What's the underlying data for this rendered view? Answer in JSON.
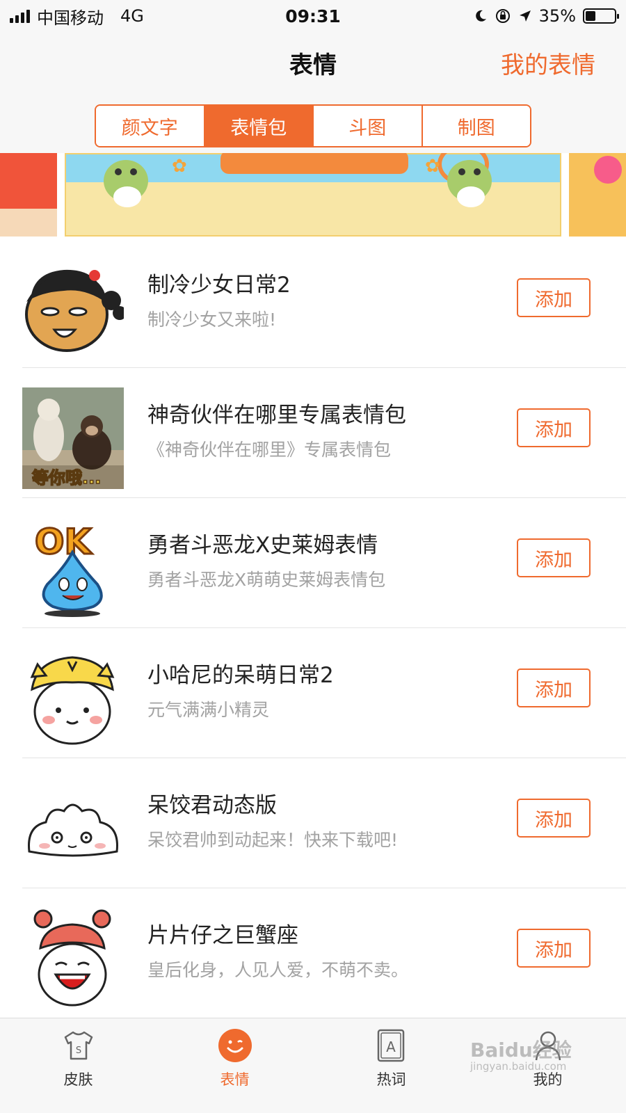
{
  "status_bar": {
    "carrier": "中国移动",
    "network": "4G",
    "time": "09:31",
    "battery": "35%",
    "battery_level": 0.35
  },
  "nav": {
    "title": "表情",
    "right_link": "我的表情"
  },
  "segments": [
    {
      "label": "颜文字",
      "active": false
    },
    {
      "label": "表情包",
      "active": true
    },
    {
      "label": "斗图",
      "active": false
    },
    {
      "label": "制图",
      "active": false
    }
  ],
  "items": [
    {
      "title": "制冷少女日常2",
      "desc": "制冷少女又来啦!",
      "button": "添加",
      "icon": "girl-face-icon"
    },
    {
      "title": "神奇伙伴在哪里专属表情包",
      "desc": "《神奇伙伴在哪里》专属表情包",
      "button": "添加",
      "icon": "dog-monkey-photo"
    },
    {
      "title": "勇者斗恶龙X史莱姆表情",
      "desc": "勇者斗恶龙X萌萌史莱姆表情包",
      "button": "添加",
      "icon": "slime-ok-icon"
    },
    {
      "title": "小哈尼的呆萌日常2",
      "desc": "元气满满小精灵",
      "button": "添加",
      "icon": "tiger-hat-kid-icon"
    },
    {
      "title": "呆饺君动态版",
      "desc": "呆饺君帅到动起来！快来下载吧!",
      "button": "添加",
      "icon": "dumpling-face-icon"
    },
    {
      "title": "片片仔之巨蟹座",
      "desc": "皇后化身，人见人爱，不萌不卖。",
      "button": "添加",
      "icon": "crab-kid-icon"
    }
  ],
  "tabs": [
    {
      "label": "皮肤",
      "icon": "shirt-icon",
      "active": false
    },
    {
      "label": "表情",
      "icon": "smile-face-icon",
      "active": true
    },
    {
      "label": "热词",
      "icon": "letter-a-icon",
      "active": false
    },
    {
      "label": "我的",
      "icon": "user-icon",
      "active": false
    }
  ],
  "watermark": {
    "text": "Baidu经验",
    "sub": "jingyan.baidu.com"
  },
  "colors": {
    "accent": "#ef6a2e",
    "background": "#f7f7f7"
  }
}
